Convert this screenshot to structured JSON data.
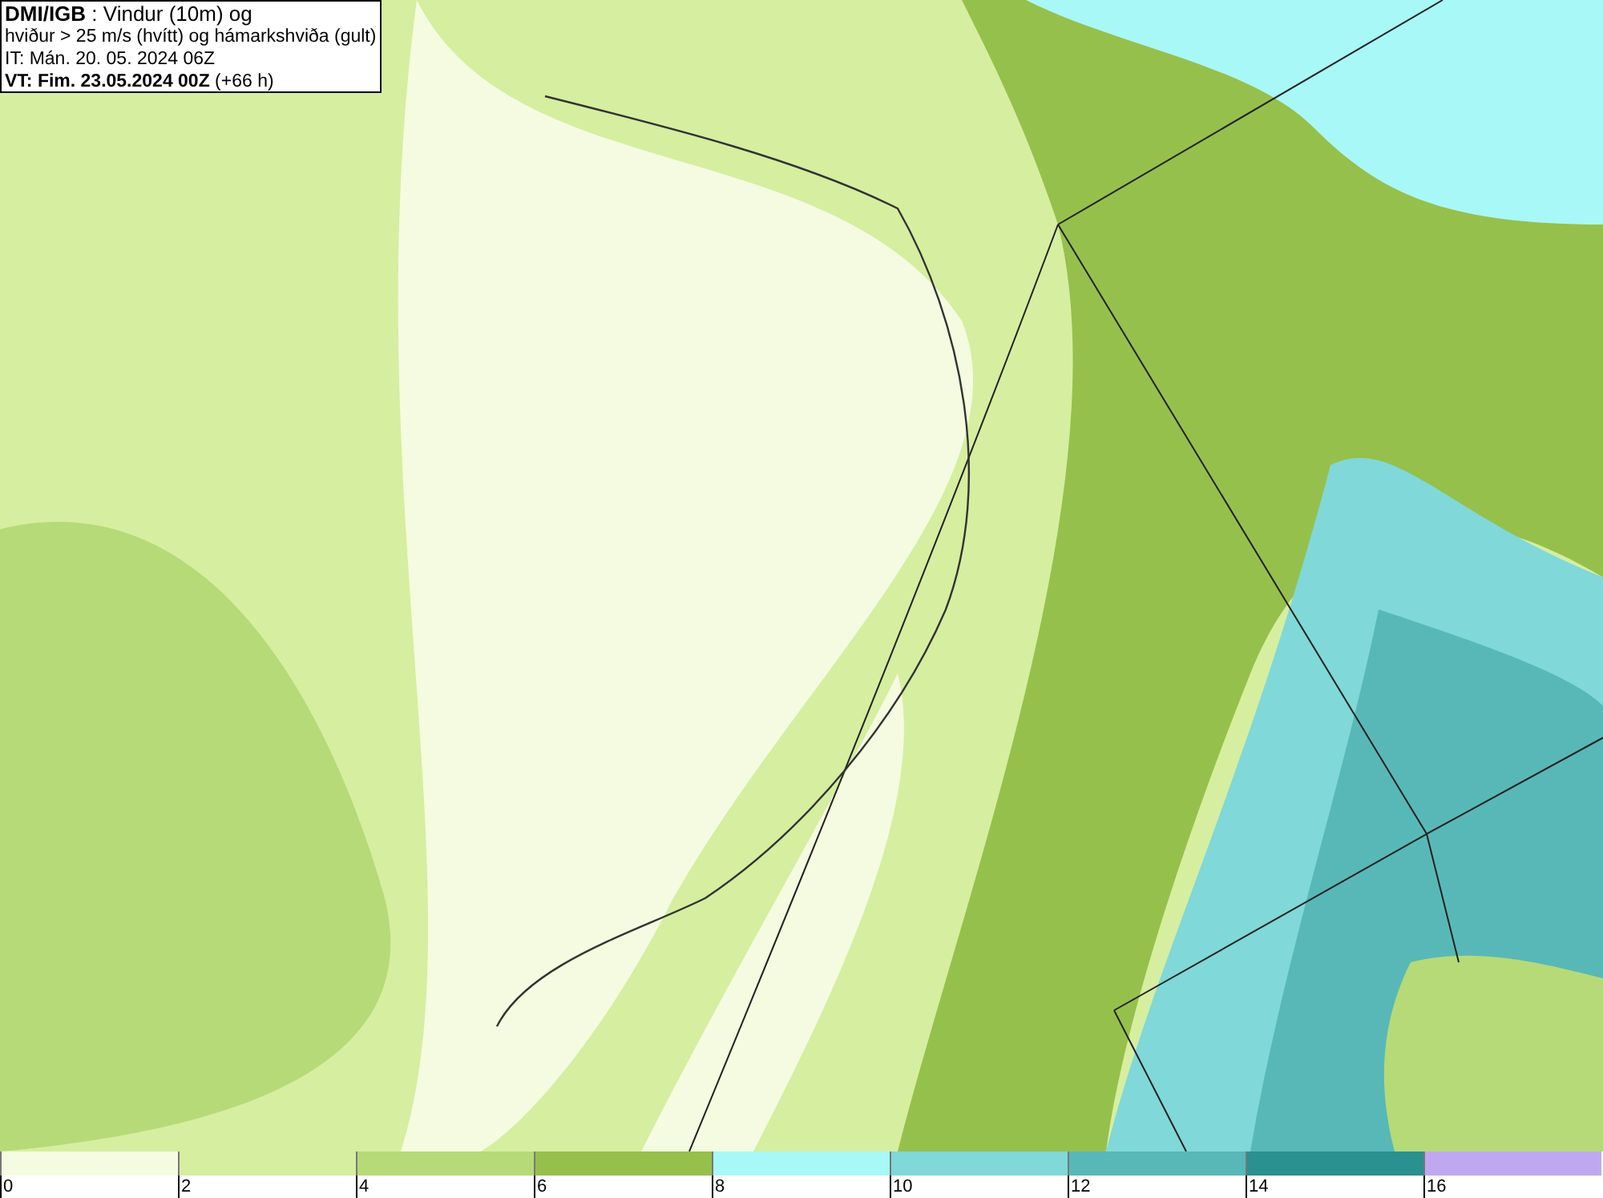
{
  "title_box": {
    "lines": [
      "**DMI/IGB** : Vindur (10m) og",
      "hviður > 25 m/s (hvítt) og hámarkshviða (gult)",
      "IT: Mán. 20. 05. 2024 06Z",
      "**VT: Fim. 23.05.2024 00Z** (+66 h)"
    ]
  },
  "legend": [
    {
      "label": "0",
      "color": "#f4fbe0"
    },
    {
      "label": "2",
      "color": "#d6eea0"
    },
    {
      "label": "4",
      "color": "#b6da78"
    },
    {
      "label": "6",
      "color": "#96c04c"
    },
    {
      "label": "8",
      "color": "#a8f8f8"
    },
    {
      "label": "10",
      "color": "#80d8d8"
    },
    {
      "label": "12",
      "color": "#58b8b8"
    },
    {
      "label": "14",
      "color": "#2a9090"
    },
    {
      "label": "16",
      "color": "#c0a8f0"
    }
  ]
}
